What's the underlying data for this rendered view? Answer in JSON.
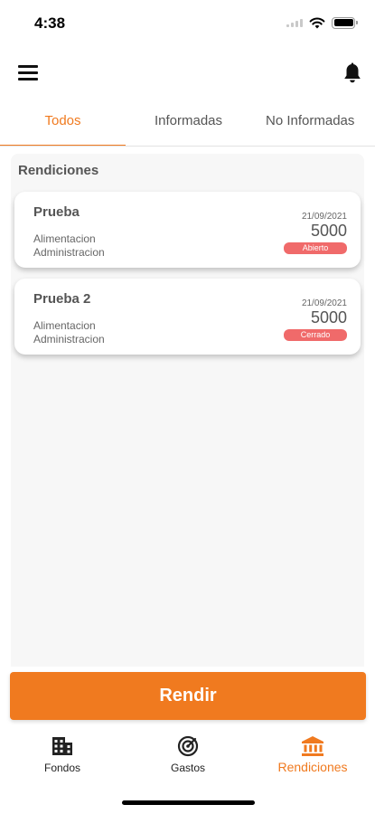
{
  "status_bar": {
    "time": "4:38"
  },
  "header": {
    "menu_icon": "hamburger-menu-icon",
    "notification_icon": "bell-icon"
  },
  "tabs": [
    {
      "label": "Todos",
      "active": true
    },
    {
      "label": "Informadas",
      "active": false
    },
    {
      "label": "No Informadas",
      "active": false
    }
  ],
  "section": {
    "title": "Rendiciones"
  },
  "cards": [
    {
      "title": "Prueba",
      "line1": "Alimentacion",
      "line2": "Administracion",
      "date": "21/09/2021",
      "amount": "5000",
      "status": "Abierto"
    },
    {
      "title": "Prueba 2",
      "line1": "Alimentacion",
      "line2": "Administracion",
      "date": "21/09/2021",
      "amount": "5000",
      "status": "Cerrado"
    }
  ],
  "primary_button": {
    "label": "Rendir"
  },
  "bottom_nav": [
    {
      "label": "Fondos",
      "icon": "building-icon",
      "active": false
    },
    {
      "label": "Gastos",
      "icon": "radar-icon",
      "active": false
    },
    {
      "label": "Rendiciones",
      "icon": "bank-icon",
      "active": true
    }
  ],
  "colors": {
    "accent": "#f07a1f",
    "badge": "#f06a6a",
    "background": "#f7f7f7"
  }
}
